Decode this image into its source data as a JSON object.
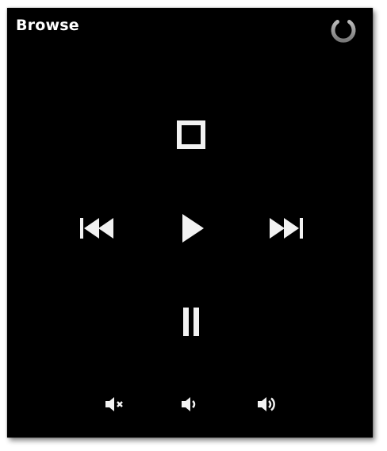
{
  "header": {
    "title": "Browse",
    "power_icon": "power-icon"
  },
  "transport": {
    "stop_icon": "stop-icon",
    "rewind_icon": "skip-previous-icon",
    "play_icon": "play-icon",
    "forward_icon": "skip-next-icon",
    "pause_icon": "pause-icon"
  },
  "volume": {
    "mute_icon": "volume-mute-icon",
    "down_icon": "volume-down-icon",
    "up_icon": "volume-up-icon"
  },
  "colors": {
    "background": "#000000",
    "foreground": "#ffffff",
    "power_icon": "#9a9a9a"
  }
}
